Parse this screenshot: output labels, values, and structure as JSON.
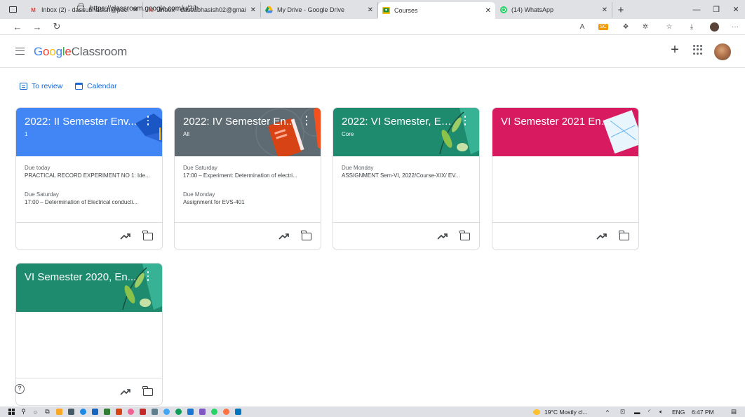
{
  "browser": {
    "tabs": [
      {
        "title": "Inbox (2) - dassubhasish@pucol",
        "icon": "gmail-icon",
        "active": false
      },
      {
        "title": "Inbox - dassubhasish02@gmail.",
        "icon": "gmail-icon",
        "active": false
      },
      {
        "title": "My Drive - Google Drive",
        "icon": "drive-icon",
        "active": false
      },
      {
        "title": "Courses",
        "icon": "classroom-icon",
        "active": true
      },
      {
        "title": "(14) WhatsApp",
        "icon": "whatsapp-icon",
        "active": false
      }
    ],
    "url": "https://classroom.google.com/u/2/h",
    "ext_sc_label": "SC"
  },
  "header": {
    "logo_google": "Google",
    "logo_product": "Classroom"
  },
  "quick_links": {
    "to_review": "To review",
    "calendar": "Calendar"
  },
  "courses": [
    {
      "title": "2022: II Semester Env...",
      "section": "1",
      "color": "#4285f4",
      "due": [
        {
          "label": "Due today",
          "item": "PRACTICAL RECORD EXPERIMENT NO 1: Ide..."
        },
        {
          "label": "Due Saturday",
          "item": "17:00 – Determination of Electrical conducti..."
        }
      ]
    },
    {
      "title": "2022: IV Semester En...",
      "section": "All",
      "color": "#5f6b72",
      "due": [
        {
          "label": "Due Saturday",
          "item": "17:00 – Experiment: Determination of electri..."
        },
        {
          "label": "Due Monday",
          "item": "Assignment for EVS-401"
        }
      ]
    },
    {
      "title": "2022: VI Semester, En...",
      "section": "Core",
      "color": "#1e8a6e",
      "due": [
        {
          "label": "Due Monday",
          "item": "ASSIGNMENT Sem-VI, 2022/Course-XIX/ EV..."
        }
      ]
    },
    {
      "title": "VI Semester 2021 Env...",
      "section": "",
      "color": "#d81b60",
      "due": []
    },
    {
      "title": "VI Semester 2020, En...",
      "section": "",
      "color": "#1e8a6e",
      "due": []
    }
  ],
  "taskbar": {
    "weather": "19°C  Mostly cl...",
    "language": "ENG",
    "time": "6:47 PM"
  }
}
